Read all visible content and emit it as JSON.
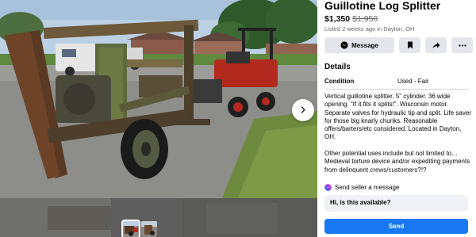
{
  "listing": {
    "title": "Guillotine Log Splitter",
    "price": "$1,350",
    "original_price": "$1,950",
    "listed": "Listed 2 weeks ago in Dayton, OH"
  },
  "actions": {
    "message_label": "Message",
    "save_icon": "bookmark-icon",
    "share_icon": "share-icon",
    "more_icon": "ellipsis-icon"
  },
  "details": {
    "heading": "Details",
    "condition_label": "Condition",
    "condition_value": "Used - Fair",
    "description_paragraphs": [
      "Vertical guillotine splitter. 5\" cylinder. 36 wide opening. \"If it fits it splits!\". Wisconsin motor. Separate valves for hydraulic tip and split. Life saver for those big knarly chunks. Reasonable offers/barters/etc considered. Located in Dayton, OH.",
      "Other potential uses include but not limited to… Medieval torture device and/or expediting payments from delinquent crews/customers?!?"
    ]
  },
  "seller_message": {
    "label": "Send seller a message",
    "input_value": "Hi, is this available?",
    "send_label": "Send"
  },
  "viewer": {
    "next_icon": "chevron-right-icon",
    "thumbnail_count": 2
  },
  "colors": {
    "accent": "#1877f2",
    "secondary_text": "#65676b",
    "button_grey": "#e4e6eb",
    "input_bg": "#f0f2f5"
  }
}
